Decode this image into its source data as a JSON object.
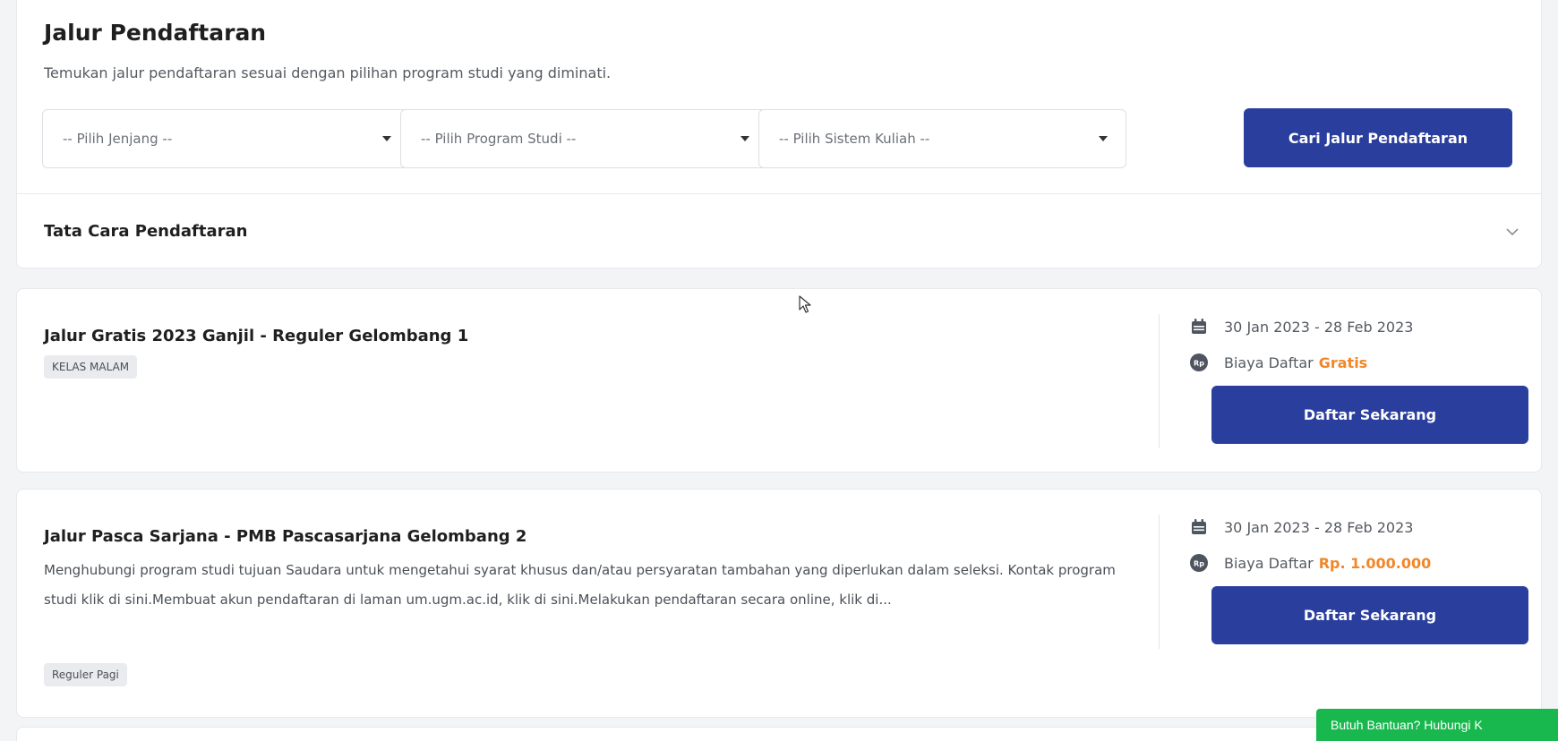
{
  "header": {
    "title": "Jalur Pendaftaran",
    "subtitle": "Temukan jalur pendaftaran sesuai dengan pilihan program studi yang diminati."
  },
  "filters": {
    "jenjang": "-- Pilih Jenjang --",
    "program_studi": "-- Pilih Program Studi --",
    "sistem_kuliah": "-- Pilih Sistem Kuliah --",
    "search_label": "Cari Jalur Pendaftaran"
  },
  "accordion": {
    "title": "Tata Cara Pendaftaran"
  },
  "cards": [
    {
      "title": "Jalur Gratis 2023 Ganjil - Reguler Gelombang 1",
      "badge": "KELAS MALAM",
      "date_range": "30 Jan 2023 - 28 Feb 2023",
      "fee_label": "Biaya Daftar",
      "fee_value": "Gratis",
      "button_label": "Daftar Sekarang"
    },
    {
      "title": "Jalur Pasca Sarjana - PMB Pascasarjana Gelombang 2",
      "description": "Menghubungi program studi tujuan Saudara untuk mengetahui syarat khusus dan/atau persyaratan tambahan yang diperlukan dalam seleksi. Kontak program studi klik di sini.Membuat akun pendaftaran di laman um.ugm.ac.id, klik di sini.Melakukan pendaftaran secara online, klik di...",
      "badge": "Reguler Pagi",
      "date_range": "30 Jan 2023 - 28 Feb 2023",
      "fee_label": "Biaya Daftar",
      "fee_value": "Rp. 1.000.000",
      "button_label": "Daftar Sekarang"
    }
  ],
  "help": {
    "label": "Butuh Bantuan? Hubungi K"
  },
  "icons": {
    "calendar": "calendar-icon",
    "fee": "rupiah-icon",
    "select": "caret-down-icon",
    "accordion": "chevron-down-icon"
  },
  "colors": {
    "primary": "#2a3e9e",
    "accent": "#f0872a",
    "help": "#19b84f"
  }
}
